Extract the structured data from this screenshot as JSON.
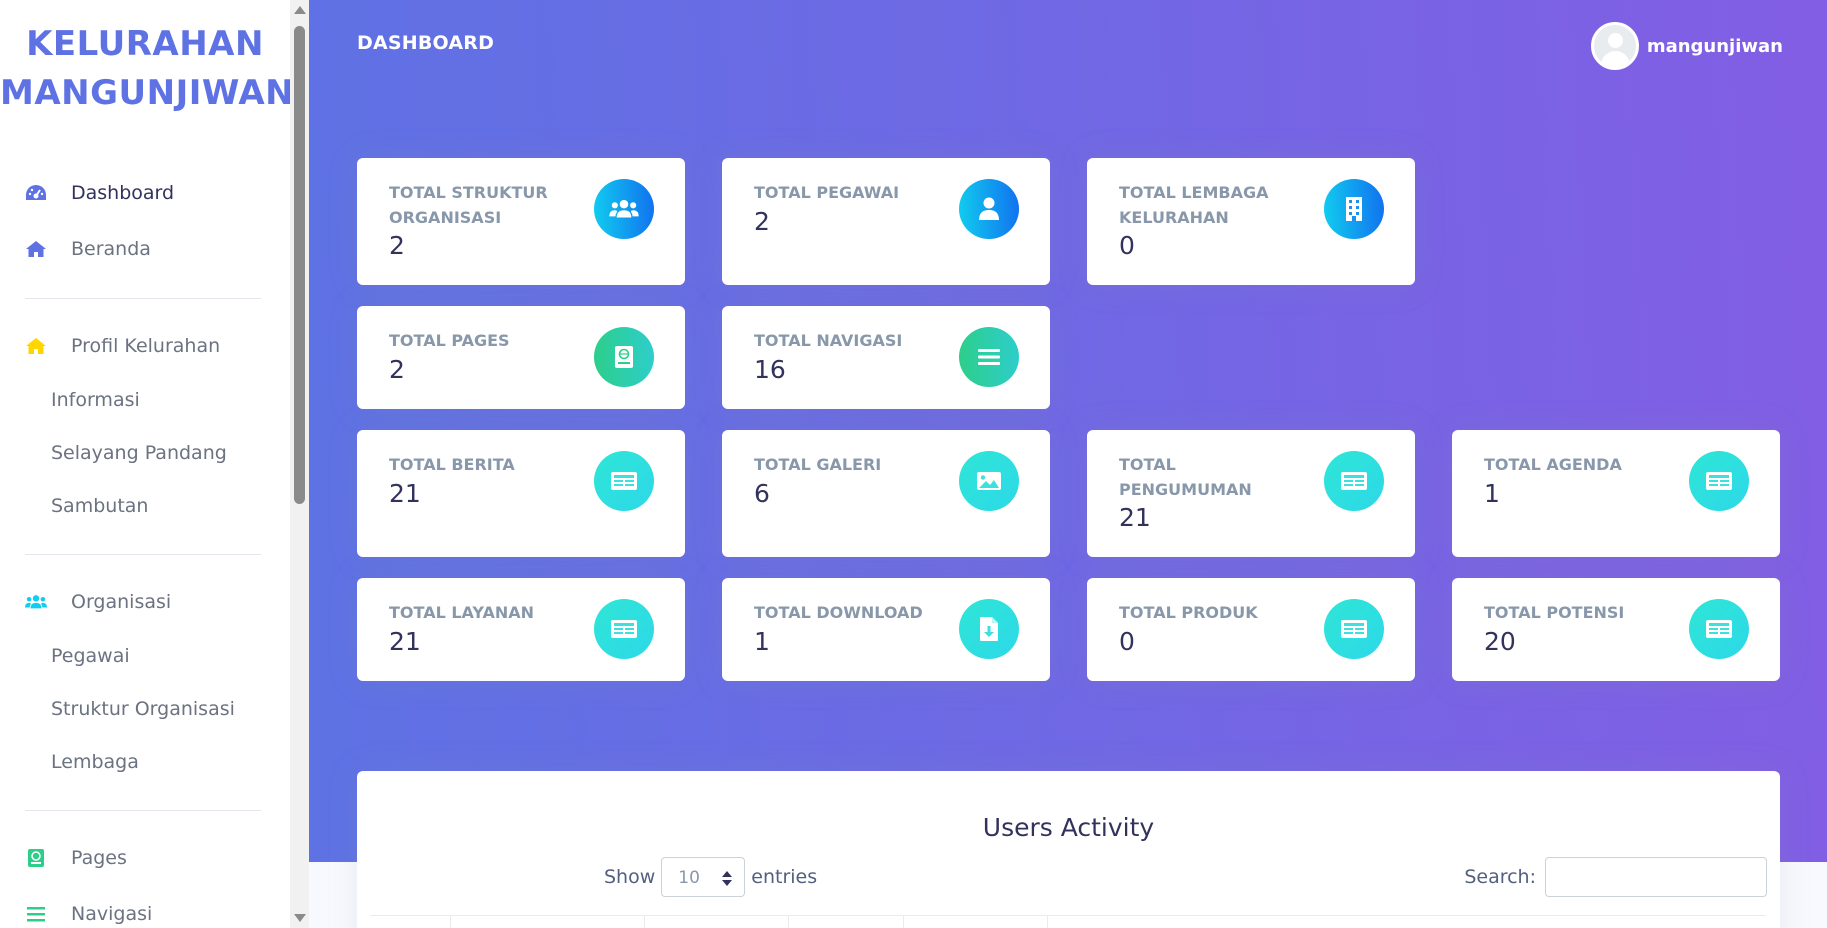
{
  "brand": {
    "line1": "KELURAHAN",
    "line2": "MANGUNJIWAN"
  },
  "sidebar": {
    "items": [
      {
        "label": "Dashboard",
        "icon": "dashboard-icon"
      },
      {
        "label": "Beranda",
        "icon": "home-icon"
      },
      {
        "label": "Profil Kelurahan",
        "icon": "home-icon"
      },
      {
        "label": "Informasi"
      },
      {
        "label": "Selayang Pandang"
      },
      {
        "label": "Sambutan"
      },
      {
        "label": "Organisasi",
        "icon": "users-icon"
      },
      {
        "label": "Pegawai"
      },
      {
        "label": "Struktur Organisasi"
      },
      {
        "label": "Lembaga"
      },
      {
        "label": "Pages",
        "icon": "book-icon"
      },
      {
        "label": "Navigasi",
        "icon": "bars-icon"
      }
    ]
  },
  "header": {
    "title": "DASHBOARD",
    "username": "mangunjiwan"
  },
  "cards": [
    {
      "title": "TOTAL STRUKTUR ORGANISASI",
      "value": "2",
      "icon": "users-icon"
    },
    {
      "title": "TOTAL PEGAWAI",
      "value": "2",
      "icon": "user-icon"
    },
    {
      "title": "TOTAL LEMBAGA KELURAHAN",
      "value": "0",
      "icon": "building-icon"
    },
    {
      "title": "TOTAL PAGES",
      "value": "2",
      "icon": "book-icon"
    },
    {
      "title": "TOTAL NAVIGASI",
      "value": "16",
      "icon": "bars-icon"
    },
    {
      "title": "TOTAL BERITA",
      "value": "21",
      "icon": "newspaper-icon"
    },
    {
      "title": "TOTAL GALERI",
      "value": "6",
      "icon": "image-icon"
    },
    {
      "title": "TOTAL PENGUMUMAN",
      "value": "21",
      "icon": "newspaper-icon"
    },
    {
      "title": "TOTAL AGENDA",
      "value": "1",
      "icon": "newspaper-icon"
    },
    {
      "title": "TOTAL LAYANAN",
      "value": "21",
      "icon": "newspaper-icon"
    },
    {
      "title": "TOTAL DOWNLOAD",
      "value": "1",
      "icon": "file-download-icon"
    },
    {
      "title": "TOTAL PRODUK",
      "value": "0",
      "icon": "newspaper-icon"
    },
    {
      "title": "TOTAL POTENSI",
      "value": "20",
      "icon": "newspaper-icon"
    }
  ],
  "table": {
    "title": "Users Activity",
    "show_label": "Show",
    "entries_value": "10",
    "entries_label": "entries",
    "search_label": "Search:"
  },
  "colors": {
    "primary": "#5e72e4",
    "gradient_end": "#825ee4",
    "blue_icon": "#1171ef",
    "green_icon": "#2dce89",
    "teal_icon": "#2ee6d6"
  }
}
